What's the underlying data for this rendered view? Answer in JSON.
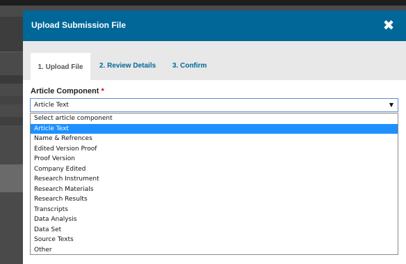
{
  "modal": {
    "title": "Upload Submission File",
    "close_icon": "times-icon",
    "close_glyph": "✖"
  },
  "tabs": [
    {
      "label": "1. Upload File",
      "active": true
    },
    {
      "label": "2. Review Details",
      "active": false
    },
    {
      "label": "3. Confirm",
      "active": false
    }
  ],
  "form": {
    "field_label": "Article Component",
    "required_marker": "*",
    "selected_value": "Article Text",
    "arrow_glyph": "▼",
    "options": [
      "Select article component",
      "Article Text",
      "Name & Refrences",
      "Edited Version Proof",
      "Proof Version",
      "Company Edited",
      "Research Instrument",
      "Research Materials",
      "Research Results",
      "Transcripts",
      "Data Analysis",
      "Data Set",
      "Source Texts",
      "Other"
    ],
    "highlighted_index": 1
  },
  "colors": {
    "header_bg": "#006798",
    "tab_link": "#006798",
    "highlight": "#1e90ff",
    "required": "#d00a0a"
  }
}
